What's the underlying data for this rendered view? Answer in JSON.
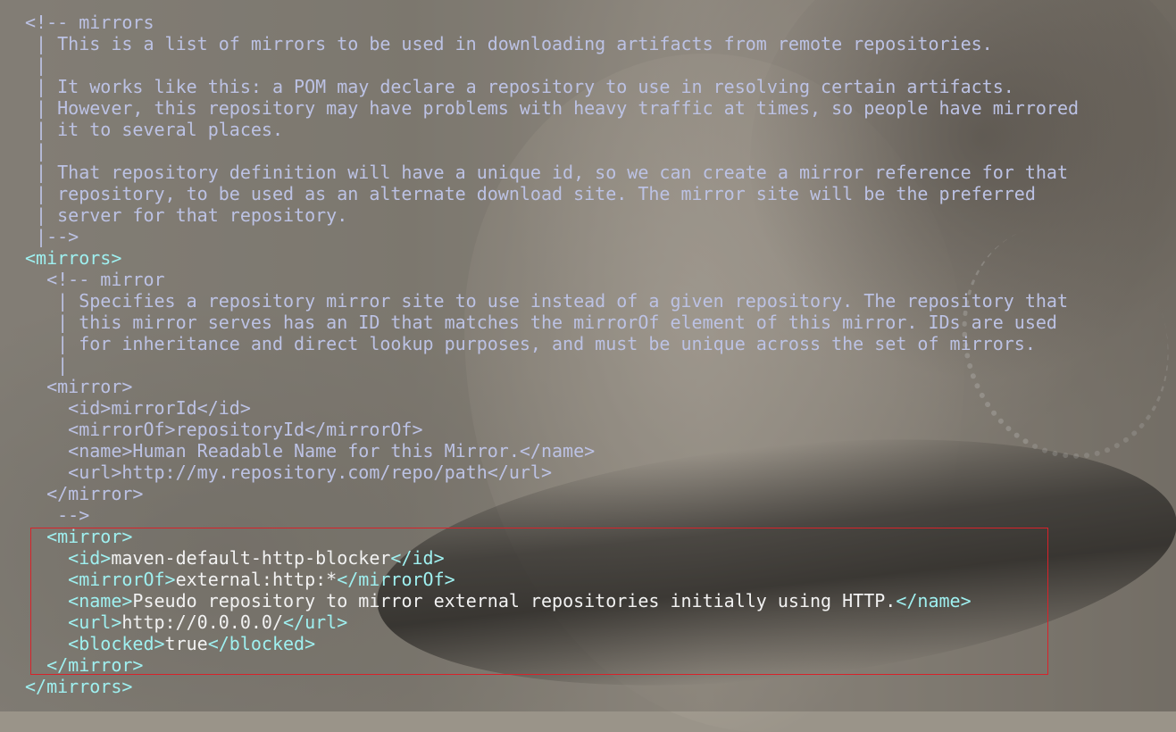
{
  "colors": {
    "comment": "#bcc2e4",
    "tag": "#9ff0f0",
    "text": "#f2f2f2",
    "highlight_border": "#d8222a"
  },
  "lines": [
    [
      {
        "t": "<!-- mirrors",
        "c": "comment"
      }
    ],
    [
      {
        "t": " | This is a list of mirrors to be used in downloading artifacts from remote repositories.",
        "c": "comment"
      }
    ],
    [
      {
        "t": " |",
        "c": "comment"
      }
    ],
    [
      {
        "t": " | It works like this: a POM may declare a repository to use in resolving certain artifacts.",
        "c": "comment"
      }
    ],
    [
      {
        "t": " | However, this repository may have problems with heavy traffic at times, so people have mirrored",
        "c": "comment"
      }
    ],
    [
      {
        "t": " | it to several places.",
        "c": "comment"
      }
    ],
    [
      {
        "t": " |",
        "c": "comment"
      }
    ],
    [
      {
        "t": " | That repository definition will have a unique id, so we can create a mirror reference for that",
        "c": "comment"
      }
    ],
    [
      {
        "t": " | repository, to be used as an alternate download site. The mirror site will be the preferred",
        "c": "comment"
      }
    ],
    [
      {
        "t": " | server for that repository.",
        "c": "comment"
      }
    ],
    [
      {
        "t": " |-->",
        "c": "comment"
      }
    ],
    [
      {
        "t": "<mirrors>",
        "c": "tag"
      }
    ],
    [
      {
        "t": "  <!-- mirror",
        "c": "comment"
      }
    ],
    [
      {
        "t": "   | Specifies a repository mirror site to use instead of a given repository. The repository that",
        "c": "comment"
      }
    ],
    [
      {
        "t": "   | this mirror serves has an ID that matches the mirrorOf element of this mirror. IDs are used",
        "c": "comment"
      }
    ],
    [
      {
        "t": "   | for inheritance and direct lookup purposes, and must be unique across the set of mirrors.",
        "c": "comment"
      }
    ],
    [
      {
        "t": "   |",
        "c": "comment"
      }
    ],
    [
      {
        "t": "  <mirror>",
        "c": "comment"
      }
    ],
    [
      {
        "t": "    <id>mirrorId</id>",
        "c": "comment"
      }
    ],
    [
      {
        "t": "    <mirrorOf>repositoryId</mirrorOf>",
        "c": "comment"
      }
    ],
    [
      {
        "t": "    <name>Human Readable Name for this Mirror.</name>",
        "c": "comment"
      }
    ],
    [
      {
        "t": "    <url>http://my.repository.com/repo/path</url>",
        "c": "comment"
      }
    ],
    [
      {
        "t": "  </mirror>",
        "c": "comment"
      }
    ],
    [
      {
        "t": "   -->",
        "c": "comment"
      }
    ],
    [
      {
        "t": "  <mirror>",
        "c": "tag"
      }
    ],
    [
      {
        "t": "    <id>",
        "c": "tag"
      },
      {
        "t": "maven-default-http-blocker",
        "c": "text"
      },
      {
        "t": "</id>",
        "c": "tag"
      }
    ],
    [
      {
        "t": "    <mirrorOf>",
        "c": "tag"
      },
      {
        "t": "external:http:*",
        "c": "text"
      },
      {
        "t": "</mirrorOf>",
        "c": "tag"
      }
    ],
    [
      {
        "t": "    <name>",
        "c": "tag"
      },
      {
        "t": "Pseudo repository to mirror external repositories initially using HTTP.",
        "c": "text"
      },
      {
        "t": "</name>",
        "c": "tag"
      }
    ],
    [
      {
        "t": "    <url>",
        "c": "tag"
      },
      {
        "t": "http://0.0.0.0/",
        "c": "text"
      },
      {
        "t": "</url>",
        "c": "tag"
      }
    ],
    [
      {
        "t": "    <blocked>",
        "c": "tag"
      },
      {
        "t": "true",
        "c": "text"
      },
      {
        "t": "</blocked>",
        "c": "tag"
      }
    ],
    [
      {
        "t": "  </mirror>",
        "c": "tag"
      }
    ],
    [
      {
        "t": "</mirrors>",
        "c": "tag"
      }
    ]
  ]
}
